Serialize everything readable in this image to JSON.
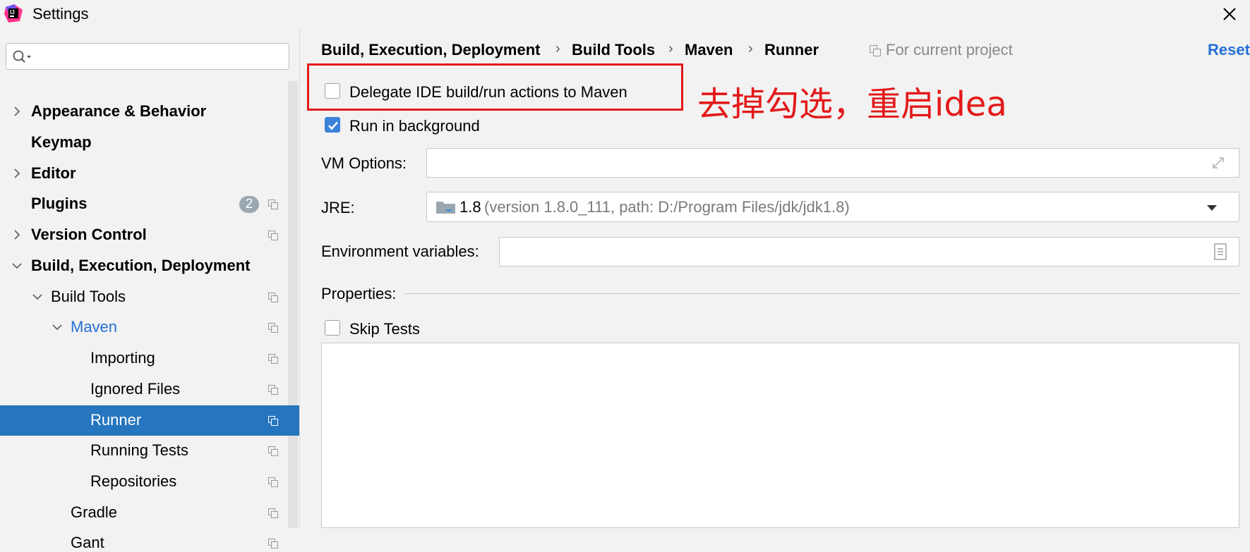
{
  "window": {
    "title": "Settings"
  },
  "search": {
    "placeholder": ""
  },
  "sidebar": {
    "items": [
      {
        "label": "Appearance & Behavior"
      },
      {
        "label": "Keymap"
      },
      {
        "label": "Editor"
      },
      {
        "label": "Plugins",
        "badge": "2"
      },
      {
        "label": "Version Control"
      },
      {
        "label": "Build, Execution, Deployment"
      },
      {
        "label": "Build Tools"
      },
      {
        "label": "Maven"
      },
      {
        "label": "Importing"
      },
      {
        "label": "Ignored Files"
      },
      {
        "label": "Runner"
      },
      {
        "label": "Running Tests"
      },
      {
        "label": "Repositories"
      },
      {
        "label": "Gradle"
      },
      {
        "label": "Gant"
      }
    ]
  },
  "breadcrumb": {
    "items": [
      "Build, Execution, Deployment",
      "Build Tools",
      "Maven",
      "Runner"
    ],
    "separator": "›",
    "scope": "For current project",
    "reset": "Reset"
  },
  "options": {
    "delegate": {
      "label": "Delegate IDE build/run actions to Maven",
      "checked": false
    },
    "background": {
      "label": "Run in background",
      "checked": true
    },
    "skip_tests": {
      "label": "Skip Tests",
      "checked": false
    }
  },
  "annotation": "去掉勾选，重启idea",
  "fields": {
    "vm_options": {
      "label": "VM Options:",
      "value": ""
    },
    "jre": {
      "label": "JRE:",
      "value": "1.8",
      "detail": "(version 1.8.0_111, path: D:/Program Files/jdk/jdk1.8)"
    },
    "env": {
      "label": "Environment variables:",
      "value": ""
    },
    "properties": {
      "label": "Properties:"
    }
  },
  "colors": {
    "accent": "#2675bf",
    "link": "#2470d6",
    "annotation": "#e41919",
    "checkbox_checked": "#3b82d9"
  },
  "icons": [
    "app-icon",
    "close-icon",
    "search-icon",
    "chevron-right-icon",
    "chevron-down-icon",
    "copy-icon",
    "folder-icon",
    "dropdown-arrow-icon",
    "expand-icon",
    "document-icon"
  ]
}
